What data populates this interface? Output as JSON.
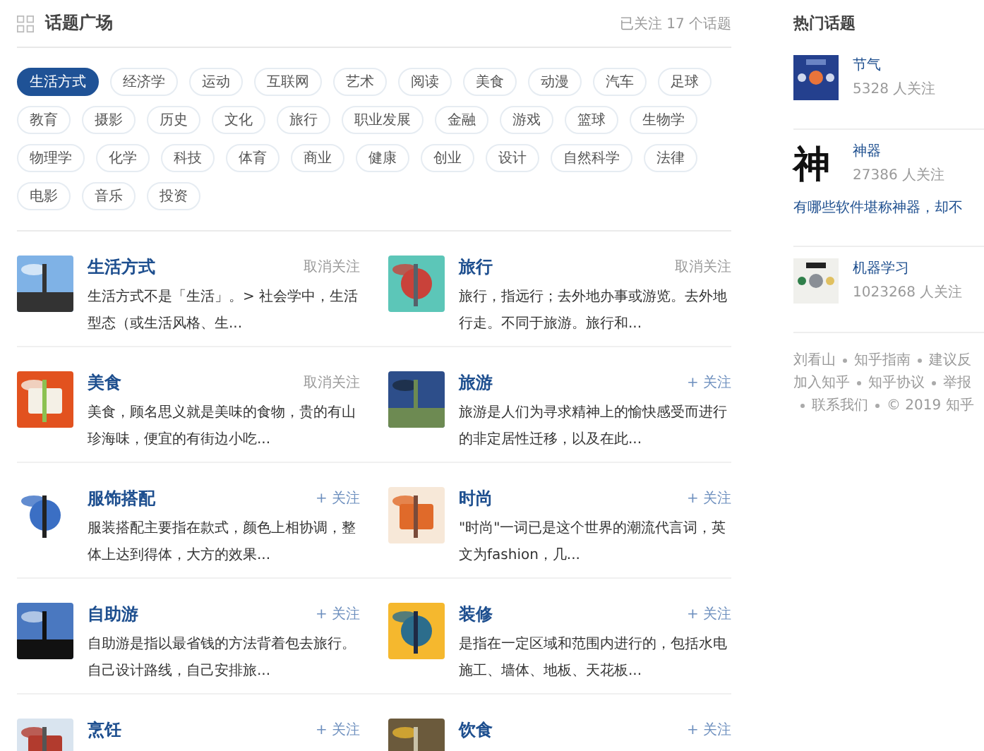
{
  "header": {
    "title": "话题广场",
    "followed_count": "已关注 17 个话题"
  },
  "tags": [
    {
      "label": "生活方式",
      "selected": true
    },
    {
      "label": "经济学",
      "selected": false
    },
    {
      "label": "运动",
      "selected": false
    },
    {
      "label": "互联网",
      "selected": false
    },
    {
      "label": "艺术",
      "selected": false
    },
    {
      "label": "阅读",
      "selected": false
    },
    {
      "label": "美食",
      "selected": false
    },
    {
      "label": "动漫",
      "selected": false
    },
    {
      "label": "汽车",
      "selected": false
    },
    {
      "label": "足球",
      "selected": false
    },
    {
      "label": "教育",
      "selected": false
    },
    {
      "label": "摄影",
      "selected": false
    },
    {
      "label": "历史",
      "selected": false
    },
    {
      "label": "文化",
      "selected": false
    },
    {
      "label": "旅行",
      "selected": false
    },
    {
      "label": "职业发展",
      "selected": false
    },
    {
      "label": "金融",
      "selected": false
    },
    {
      "label": "游戏",
      "selected": false
    },
    {
      "label": "篮球",
      "selected": false
    },
    {
      "label": "生物学",
      "selected": false
    },
    {
      "label": "物理学",
      "selected": false
    },
    {
      "label": "化学",
      "selected": false
    },
    {
      "label": "科技",
      "selected": false
    },
    {
      "label": "体育",
      "selected": false
    },
    {
      "label": "商业",
      "selected": false
    },
    {
      "label": "健康",
      "selected": false
    },
    {
      "label": "创业",
      "selected": false
    },
    {
      "label": "设计",
      "selected": false
    },
    {
      "label": "自然科学",
      "selected": false
    },
    {
      "label": "法律",
      "selected": false
    },
    {
      "label": "电影",
      "selected": false
    },
    {
      "label": "音乐",
      "selected": false
    },
    {
      "label": "投资",
      "selected": false
    }
  ],
  "topics": [
    {
      "title": "生活方式",
      "followed": true,
      "action": "取消关注",
      "description": "生活方式不是「生活」。> 社会学中，生活型态（或生活风格、生..."
    },
    {
      "title": "旅行",
      "followed": true,
      "action": "取消关注",
      "description": "旅行，指远行；去外地办事或游览。去外地行走。不同于旅游。旅行和..."
    },
    {
      "title": "美食",
      "followed": true,
      "action": "取消关注",
      "description": "美食，顾名思义就是美味的食物，贵的有山珍海味，便宜的有街边小吃..."
    },
    {
      "title": "旅游",
      "followed": false,
      "action": "+ 关注",
      "description": "旅游是人们为寻求精神上的愉快感受而进行的非定居性迁移，以及在此..."
    },
    {
      "title": "服饰搭配",
      "followed": false,
      "action": "+ 关注",
      "description": "服装搭配主要指在款式，颜色上相协调，整体上达到得体，大方的效果..."
    },
    {
      "title": "时尚",
      "followed": false,
      "action": "+ 关注",
      "description": "\"时尚\"一词已是这个世界的潮流代言词，英文为fashion，几..."
    },
    {
      "title": "自助游",
      "followed": false,
      "action": "+ 关注",
      "description": "自助游是指以最省钱的方法背着包去旅行。自己设计路线，自己安排旅..."
    },
    {
      "title": "装修",
      "followed": false,
      "action": "+ 关注",
      "description": "是指在一定区域和范围内进行的，包括水电施工、墙体、地板、天花板..."
    },
    {
      "title": "烹饪",
      "followed": false,
      "action": "+ 关注"
    },
    {
      "title": "饮食",
      "followed": false,
      "action": "+ 关注"
    }
  ],
  "sidebar": {
    "title": "热门话题",
    "items": [
      {
        "name": "节气",
        "followers": "5328 人关注"
      },
      {
        "name": "神器",
        "avatar_text": "神",
        "followers": "27386 人关注",
        "question": "有哪些软件堪称神器，却不"
      },
      {
        "name": "机器学习",
        "followers": "1023268 人关注"
      }
    ],
    "footer": [
      [
        "刘看山",
        "知乎指南",
        "建议反"
      ],
      [
        "加入知乎",
        "知乎协议",
        "举报"
      ],
      [
        "联系我们",
        "© 2019 知乎"
      ]
    ]
  }
}
